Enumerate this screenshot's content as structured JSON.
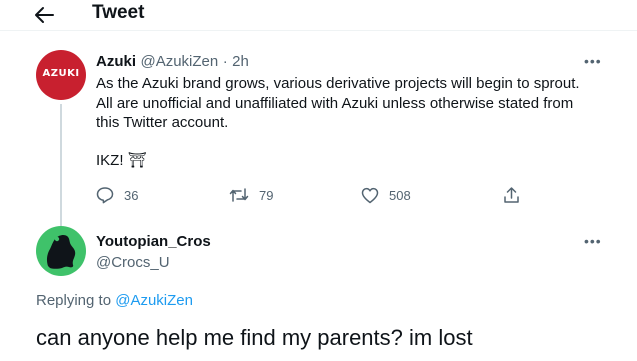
{
  "header": {
    "title": "Tweet",
    "back_icon": "arrow-left-icon"
  },
  "tweet": {
    "avatar_text": "AZUKI",
    "author_name": "Azuki",
    "author_handle": "@AzukiZen",
    "separator": "·",
    "time": "2h",
    "more": "•••",
    "text": "As the Azuki brand grows, various derivative projects will begin to sprout. All are unofficial and unaffiliated with Azuki unless otherwise stated from this Twitter account.",
    "text2": "IKZ! ⛩",
    "actions": {
      "replies": "36",
      "retweets": "79",
      "likes": "508"
    }
  },
  "reply": {
    "author_name": "Youtopian_Cros",
    "author_handle": "@Crocs_U",
    "more": "•••",
    "replying_prefix": "Replying to",
    "replying_to": "@AzukiZen",
    "text": "can anyone help me find my parents? im lost"
  },
  "colors": {
    "accent": "#1d9bf0",
    "azuki_red": "#c8202f",
    "avatar_green": "#3fc26a",
    "secondary_text": "#536471"
  }
}
